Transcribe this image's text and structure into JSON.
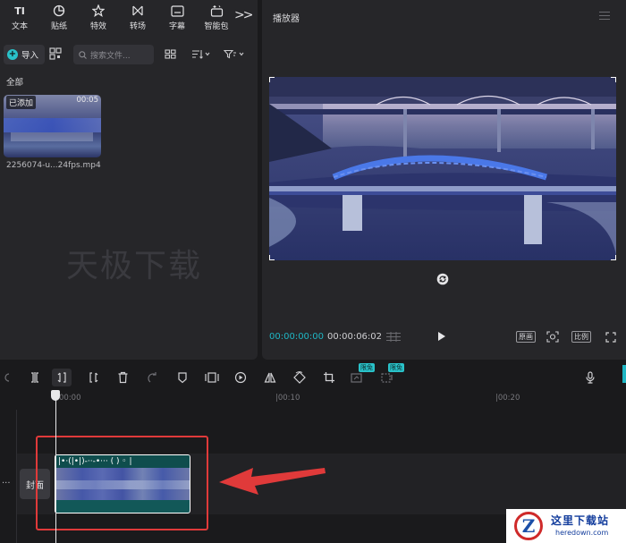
{
  "categories": [
    {
      "icon": "text-icon",
      "glyph": "TI",
      "label": "文本"
    },
    {
      "icon": "sticker-icon",
      "glyph": "",
      "label": "贴纸"
    },
    {
      "icon": "effects-icon",
      "glyph": "",
      "label": "特效"
    },
    {
      "icon": "transition-icon",
      "glyph": "",
      "label": "转场"
    },
    {
      "icon": "subtitle-icon",
      "glyph": "",
      "label": "字幕"
    },
    {
      "icon": "smart-package-icon",
      "glyph": "",
      "label": "智能包"
    }
  ],
  "more_glyph": ">>",
  "media": {
    "import_label": "导入",
    "search_placeholder": "搜索文件...",
    "section": "全部",
    "item": {
      "badge": "已添加",
      "duration": "00:05",
      "filename": "2256074-u...24fps.mp4"
    },
    "watermark": "天极下载"
  },
  "player": {
    "title": "播放器",
    "current_time": "00:00:00:00",
    "total_time": "00:00:06:02",
    "original_label": "原画",
    "ratio_label": "比例"
  },
  "timeline": {
    "free_tag": "限免",
    "ruler_ticks": [
      "00:00",
      "|00:10",
      "|00:20"
    ],
    "cover_label": "封面",
    "more_dots": "···",
    "clip_wave": "|•·(|•|)-··-•··· ( ) ◦ |"
  },
  "logo": {
    "letter": "Z",
    "title": "这里下载站",
    "url": "heredown.com"
  },
  "colors": {
    "accent": "#29c2c9",
    "timecode": "#1fb6c4",
    "highlight": "#e03a3a",
    "clip": "#125858"
  }
}
